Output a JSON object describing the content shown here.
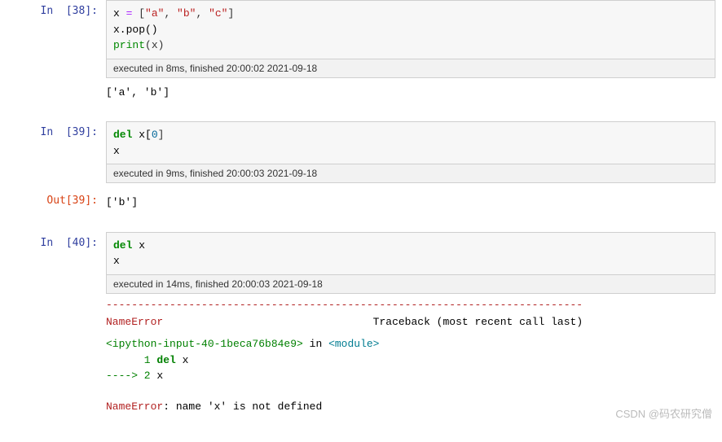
{
  "cells": [
    {
      "in_prompt": "In  [38]:",
      "code_tokens": {
        "l1": {
          "a": "x ",
          "op": "=",
          "b": " [",
          "s1": "\"a\"",
          "c1": ", ",
          "s2": "\"b\"",
          "c2": ", ",
          "s3": "\"c\"",
          "d": "]"
        },
        "l2": {
          "a": "x.pop()"
        },
        "l3": {
          "fn": "print",
          "args": "(x)"
        }
      },
      "exec": "executed in 8ms, finished 20:00:02 2021-09-18",
      "output": "['a', 'b']"
    },
    {
      "in_prompt": "In  [39]:",
      "code_tokens": {
        "l1": {
          "kw": "del",
          "rest": " x[",
          "idx": "0",
          "end": "]"
        },
        "l2": {
          "a": "x"
        }
      },
      "exec": "executed in 9ms, finished 20:00:03 2021-09-18",
      "out_prompt": "Out[39]:",
      "output": "['b']"
    },
    {
      "in_prompt": "In  [40]:",
      "code_tokens": {
        "l1": {
          "kw": "del",
          "rest": " x"
        },
        "l2": {
          "a": "x"
        }
      },
      "exec": "executed in 14ms, finished 20:00:03 2021-09-18",
      "error": {
        "dash": "---------------------------------------------------------------------------",
        "name": "NameError",
        "tb_label": "Traceback (most recent call last)",
        "frame_src": "<ipython-input-40-1beca76b84e9>",
        "in_word": " in ",
        "module": "<module>",
        "line1_num": "      1 ",
        "line1_kw": "del",
        "line1_rest": " x",
        "arrow": "----> 2 ",
        "l2": "x",
        "final_name": "NameError",
        "final_msg": ": name 'x' is not defined"
      }
    }
  ],
  "watermark": "CSDN @码农研究僧"
}
